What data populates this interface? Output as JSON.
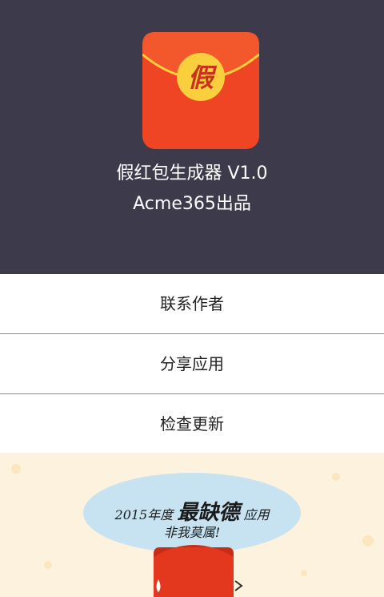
{
  "header": {
    "icon_char": "假",
    "app_name": "假红包生成器 V1.0",
    "credit": "Acme365出品"
  },
  "menu": {
    "items": [
      {
        "label": "联系作者"
      },
      {
        "label": "分享应用"
      },
      {
        "label": "检查更新"
      }
    ]
  },
  "banner": {
    "prefix": "2015年度",
    "highlight": "最缺德",
    "suffix": "应用",
    "line2": "非我莫属!"
  },
  "colors": {
    "header_bg": "#3d3b4b",
    "envelope_red": "#ef4524",
    "envelope_gold": "#f9cf3e",
    "banner_bg": "#fdf2dd"
  }
}
